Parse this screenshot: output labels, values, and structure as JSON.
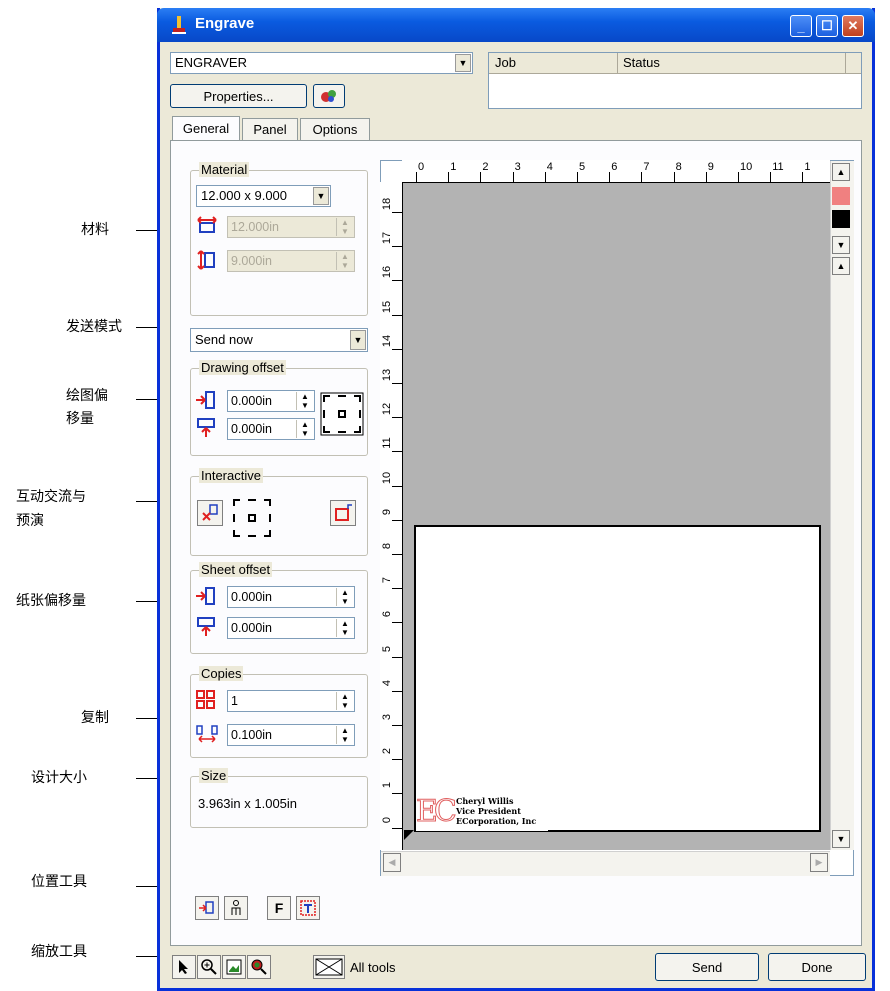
{
  "annotations": {
    "material": "材料",
    "send_mode": "发送模式",
    "drawing_offset_1": "绘图偏",
    "drawing_offset_2": "移量",
    "interactive_1": "互动交流与",
    "interactive_2": "预演",
    "sheet_offset": "纸张偏移量",
    "copies": "复制",
    "design_size": "设计大小",
    "position_tools": "位置工具",
    "zoom_tools": "缩放工具"
  },
  "window": {
    "title": "Engrave"
  },
  "printer": {
    "selected": "ENGRAVER",
    "properties_label": "Properties..."
  },
  "job_list": {
    "columns": [
      "Job",
      "Status"
    ]
  },
  "tabs": [
    "General",
    "Panel",
    "Options"
  ],
  "material": {
    "label": "Material",
    "size_value": "12.000 x 9.000",
    "width_value": "12.000in",
    "height_value": "9.000in"
  },
  "send_mode": {
    "value": "Send now"
  },
  "drawing_offset": {
    "label": "Drawing offset",
    "x_value": "0.000in",
    "y_value": "0.000in"
  },
  "interactive": {
    "label": "Interactive"
  },
  "sheet_offset": {
    "label": "Sheet offset",
    "x_value": "0.000in",
    "y_value": "0.000in"
  },
  "copies": {
    "label": "Copies",
    "count_value": "1",
    "spacing_value": "0.100in"
  },
  "size": {
    "label": "Size",
    "value": "3.963in x 1.005in"
  },
  "ruler": {
    "top_labels": [
      "0",
      "1",
      "2",
      "3",
      "4",
      "5",
      "6",
      "7",
      "8",
      "9",
      "10",
      "11",
      "1"
    ],
    "left_labels": [
      "18",
      "17",
      "16",
      "15",
      "14",
      "13",
      "12",
      "11",
      "10",
      "9",
      "8",
      "7",
      "6",
      "5",
      "4",
      "3",
      "2",
      "1",
      "0"
    ]
  },
  "preview_card": {
    "logo": "EC",
    "line1": "Cheryl Willis",
    "line2": "Vice President",
    "line3": "ECorporation, Inc"
  },
  "bottom_bar": {
    "all_tools_label": "All tools",
    "send_label": "Send",
    "done_label": "Done"
  },
  "colors": {
    "titlebar": "#0a5be0",
    "window_bg": "#ece9d8",
    "canvas_gray": "#b3b3b3",
    "swatch_red": "#f08080"
  }
}
